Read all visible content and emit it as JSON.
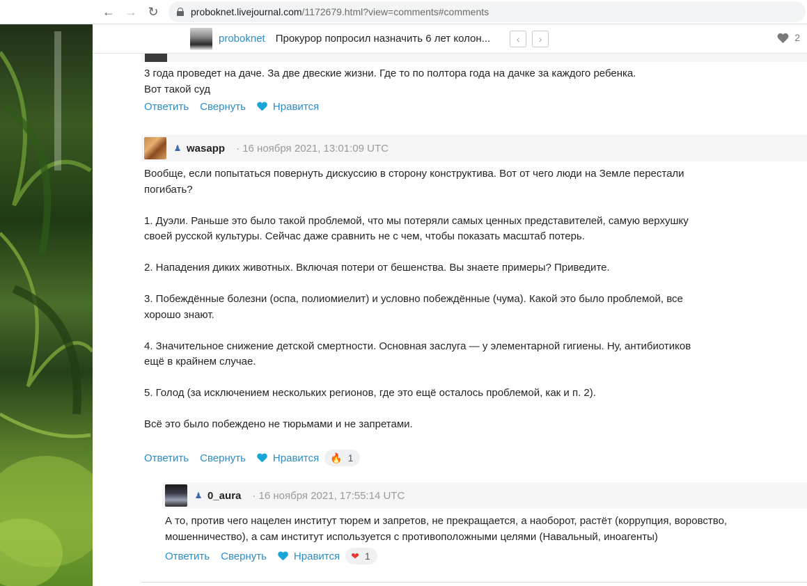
{
  "browser": {
    "url_host": "proboknet.livejournal.com",
    "url_path": "/1172679.html?view=comments#comments"
  },
  "header": {
    "username": "proboknet",
    "post_title": "Прокурор попросил назначить 6 лет колон...",
    "like_count": "2"
  },
  "comments": [
    {
      "text": "3 года проведет на даче. За две двеские жизни. Где то по полтора года на дачке за каждого ребенка.\nВот такой суд",
      "reply_label": "Ответить",
      "collapse_label": "Свернуть",
      "like_label": "Нравится"
    },
    {
      "username": "wasapp",
      "date": "· 16 ноября 2021, 13:01:09 UTC",
      "text": "Вообще, если попытаться повернуть дискуссию в сторону конструктива. Вот от чего люди на Земле перестали\nпогибать?\n\n1. Дуэли. Раньше это было такой проблемой, что мы потеряли самых ценных представителей, самую верхушку\nсвоей русской культуры. Сейчас даже сравнить не с чем, чтобы показать масштаб потерь.\n\n2. Нападения диких животных. Включая потери от бешенства. Вы знаете примеры? Приведите.\n\n3. Побеждённые болезни (оспа, полиомиелит) и условно побеждённые (чума). Какой это было проблемой, все\nхорошо знают.\n\n4. Значительное снижение детской смертности. Основная заслуга — у элементарной гигиены. Ну, антибиотиков\nещё в крайнем случае.\n\n5. Голод (за исключением нескольких регионов, где это ещё осталось проблемой, как и п. 2).\n\nВсё это было побеждено не тюрьмами и не запретами.",
      "reply_label": "Ответить",
      "collapse_label": "Свернуть",
      "like_label": "Нравится",
      "reaction_emoji": "🔥",
      "reaction_count": "1"
    },
    {
      "username": "0_aura",
      "date": "· 16 ноября 2021, 17:55:14 UTC",
      "text": "А то, против чего нацелен институт тюрем и запретов, не прекращается, а наоборот, растёт (коррупция, воровство,\nмошенничество), а сам институт используется с противоположными целями (Навальный, иноагенты)",
      "reply_label": "Ответить",
      "collapse_label": "Свернуть",
      "like_label": "Нравится",
      "reaction_emoji": "❤",
      "reaction_count": "1"
    }
  ],
  "colors": {
    "link": "#2b8cc7",
    "heart": "#1aa7d7",
    "header_bg": "#f5f5f5"
  }
}
